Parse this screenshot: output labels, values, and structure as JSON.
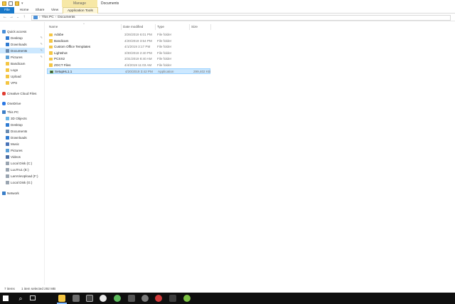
{
  "window": {
    "context_tab": "Manage",
    "title": "Documents"
  },
  "ribbon": {
    "tabs": [
      "File",
      "Home",
      "Share",
      "View",
      "Application Tools"
    ]
  },
  "address": {
    "path": [
      "This PC",
      "Documents"
    ]
  },
  "sidebar": {
    "quick_access": "Quick access",
    "items": [
      {
        "label": "Desktop",
        "pinned": true
      },
      {
        "label": "Downloads",
        "pinned": true
      },
      {
        "label": "Documents",
        "pinned": true
      },
      {
        "label": "Pictures",
        "pinned": true
      },
      {
        "label": "Bandicam"
      },
      {
        "label": "Logo"
      },
      {
        "label": "Upload"
      },
      {
        "label": "VPS"
      }
    ],
    "creative_cloud": "Creative Cloud Files",
    "onedrive": "OneDrive",
    "this_pc": "This PC",
    "pc_items": [
      "3D Objects",
      "Desktop",
      "Documents",
      "Downloads",
      "Music",
      "Pictures",
      "Videos",
      "Local Disk (C:)",
      "LuuTru1 (E:)",
      "LamVieUpload (F:)",
      "Local Disk (G:)"
    ],
    "network": "Network"
  },
  "columns": {
    "name": "Name",
    "date": "Date modified",
    "type": "Type",
    "size": "Size"
  },
  "files": [
    {
      "name": "Adobe",
      "date": "3/26/2019 6:01 PM",
      "type": "File folder",
      "size": ""
    },
    {
      "name": "Bandicam",
      "date": "4/20/2019 3:54 PM",
      "type": "File folder",
      "size": ""
    },
    {
      "name": "Custom Office Templates",
      "date": "4/1/2019 3:17 PM",
      "type": "File folder",
      "size": ""
    },
    {
      "name": "Lightshot",
      "date": "3/30/2019 2:40 PM",
      "type": "File folder",
      "size": ""
    },
    {
      "name": "PCSX2",
      "date": "3/31/2019 8:40 AM",
      "type": "File folder",
      "size": ""
    },
    {
      "name": "ZOCT Files",
      "date": "4/4/2019 11:03 AM",
      "type": "File folder",
      "size": ""
    },
    {
      "name": "SetupHL1.1",
      "date": "4/20/2019 3:42 PM",
      "type": "Application",
      "size": "299,402 KB"
    }
  ],
  "status": {
    "items": "7 items",
    "selected": "1 item selected  292 MB"
  },
  "colors": {
    "file_tab": "#1979ca",
    "selection": "#cce8ff",
    "taskbar": "#0f0f0f"
  }
}
